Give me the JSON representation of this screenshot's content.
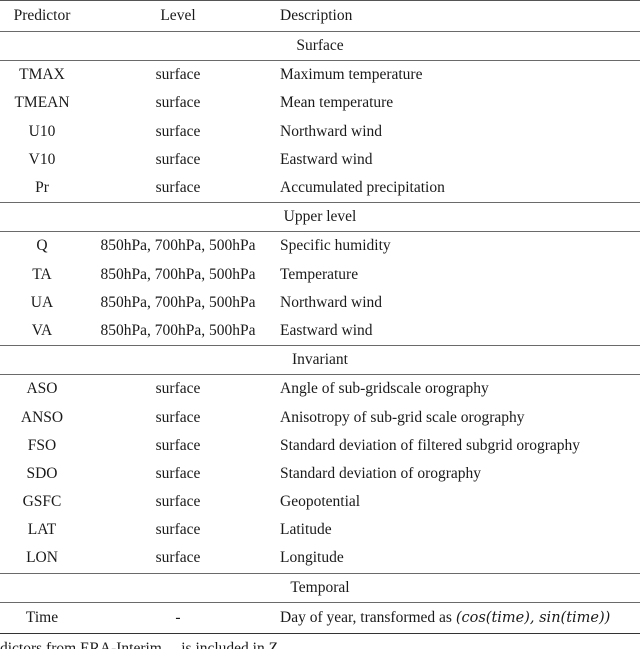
{
  "table": {
    "headers": {
      "predictor": "Predictor",
      "level": "Level",
      "description": "Description"
    },
    "groups": [
      {
        "title": "Surface",
        "rows": [
          {
            "predictor": "TMAX",
            "level": "surface",
            "description": "Maximum temperature"
          },
          {
            "predictor": "TMEAN",
            "level": "surface",
            "description": "Mean temperature"
          },
          {
            "predictor": "U10",
            "level": "surface",
            "description": "Northward wind"
          },
          {
            "predictor": "V10",
            "level": "surface",
            "description": "Eastward wind"
          },
          {
            "predictor": "Pr",
            "level": "surface",
            "description": "Accumulated precipitation"
          }
        ]
      },
      {
        "title": "Upper level",
        "rows": [
          {
            "predictor": "Q",
            "level": "850hPa, 700hPa, 500hPa",
            "description": "Specific humidity"
          },
          {
            "predictor": "TA",
            "level": "850hPa, 700hPa, 500hPa",
            "description": "Temperature"
          },
          {
            "predictor": "UA",
            "level": "850hPa, 700hPa, 500hPa",
            "description": "Northward wind"
          },
          {
            "predictor": "VA",
            "level": "850hPa, 700hPa, 500hPa",
            "description": "Eastward wind"
          }
        ]
      },
      {
        "title": "Invariant",
        "rows": [
          {
            "predictor": "ASO",
            "level": "surface",
            "description": "Angle of sub-gridscale orography"
          },
          {
            "predictor": "ANSO",
            "level": "surface",
            "description": "Anisotropy of sub-grid scale orography"
          },
          {
            "predictor": "FSO",
            "level": "surface",
            "description": "Standard deviation of filtered subgrid orography"
          },
          {
            "predictor": "SDO",
            "level": "surface",
            "description": "Standard deviation of orography"
          },
          {
            "predictor": "GSFC",
            "level": "surface",
            "description": "Geopotential"
          },
          {
            "predictor": "LAT",
            "level": "surface",
            "description": "Latitude"
          },
          {
            "predictor": "LON",
            "level": "surface",
            "description": "Longitude"
          }
        ]
      },
      {
        "title": "Temporal",
        "rows": [
          {
            "predictor": "Time",
            "level": "-",
            "description_prefix": "Day of year, transformed as ",
            "description_math": "(cos(time), sin(time))"
          }
        ]
      }
    ]
  },
  "caption_partial": "dictors from ERA-Interim ... is included in Z..."
}
